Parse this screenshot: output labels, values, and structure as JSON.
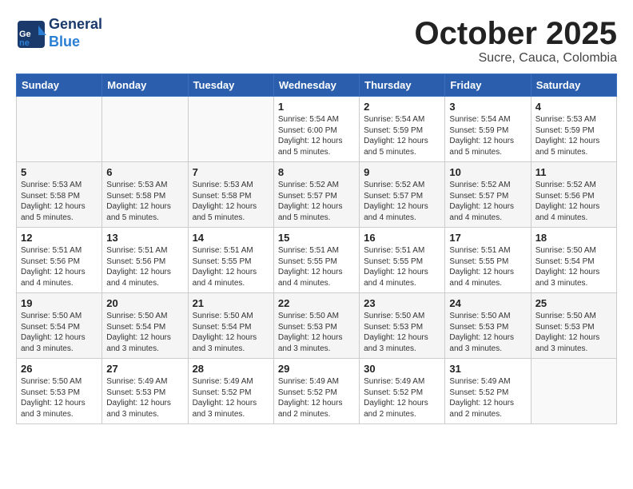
{
  "header": {
    "logo_general": "General",
    "logo_blue": "Blue",
    "month_title": "October 2025",
    "subtitle": "Sucre, Cauca, Colombia"
  },
  "calendar": {
    "days_of_week": [
      "Sunday",
      "Monday",
      "Tuesday",
      "Wednesday",
      "Thursday",
      "Friday",
      "Saturday"
    ],
    "weeks": [
      [
        {
          "day": "",
          "info": ""
        },
        {
          "day": "",
          "info": ""
        },
        {
          "day": "",
          "info": ""
        },
        {
          "day": "1",
          "info": "Sunrise: 5:54 AM\nSunset: 6:00 PM\nDaylight: 12 hours and 5 minutes."
        },
        {
          "day": "2",
          "info": "Sunrise: 5:54 AM\nSunset: 5:59 PM\nDaylight: 12 hours and 5 minutes."
        },
        {
          "day": "3",
          "info": "Sunrise: 5:54 AM\nSunset: 5:59 PM\nDaylight: 12 hours and 5 minutes."
        },
        {
          "day": "4",
          "info": "Sunrise: 5:53 AM\nSunset: 5:59 PM\nDaylight: 12 hours and 5 minutes."
        }
      ],
      [
        {
          "day": "5",
          "info": "Sunrise: 5:53 AM\nSunset: 5:58 PM\nDaylight: 12 hours and 5 minutes."
        },
        {
          "day": "6",
          "info": "Sunrise: 5:53 AM\nSunset: 5:58 PM\nDaylight: 12 hours and 5 minutes."
        },
        {
          "day": "7",
          "info": "Sunrise: 5:53 AM\nSunset: 5:58 PM\nDaylight: 12 hours and 5 minutes."
        },
        {
          "day": "8",
          "info": "Sunrise: 5:52 AM\nSunset: 5:57 PM\nDaylight: 12 hours and 5 minutes."
        },
        {
          "day": "9",
          "info": "Sunrise: 5:52 AM\nSunset: 5:57 PM\nDaylight: 12 hours and 4 minutes."
        },
        {
          "day": "10",
          "info": "Sunrise: 5:52 AM\nSunset: 5:57 PM\nDaylight: 12 hours and 4 minutes."
        },
        {
          "day": "11",
          "info": "Sunrise: 5:52 AM\nSunset: 5:56 PM\nDaylight: 12 hours and 4 minutes."
        }
      ],
      [
        {
          "day": "12",
          "info": "Sunrise: 5:51 AM\nSunset: 5:56 PM\nDaylight: 12 hours and 4 minutes."
        },
        {
          "day": "13",
          "info": "Sunrise: 5:51 AM\nSunset: 5:56 PM\nDaylight: 12 hours and 4 minutes."
        },
        {
          "day": "14",
          "info": "Sunrise: 5:51 AM\nSunset: 5:55 PM\nDaylight: 12 hours and 4 minutes."
        },
        {
          "day": "15",
          "info": "Sunrise: 5:51 AM\nSunset: 5:55 PM\nDaylight: 12 hours and 4 minutes."
        },
        {
          "day": "16",
          "info": "Sunrise: 5:51 AM\nSunset: 5:55 PM\nDaylight: 12 hours and 4 minutes."
        },
        {
          "day": "17",
          "info": "Sunrise: 5:51 AM\nSunset: 5:55 PM\nDaylight: 12 hours and 4 minutes."
        },
        {
          "day": "18",
          "info": "Sunrise: 5:50 AM\nSunset: 5:54 PM\nDaylight: 12 hours and 3 minutes."
        }
      ],
      [
        {
          "day": "19",
          "info": "Sunrise: 5:50 AM\nSunset: 5:54 PM\nDaylight: 12 hours and 3 minutes."
        },
        {
          "day": "20",
          "info": "Sunrise: 5:50 AM\nSunset: 5:54 PM\nDaylight: 12 hours and 3 minutes."
        },
        {
          "day": "21",
          "info": "Sunrise: 5:50 AM\nSunset: 5:54 PM\nDaylight: 12 hours and 3 minutes."
        },
        {
          "day": "22",
          "info": "Sunrise: 5:50 AM\nSunset: 5:53 PM\nDaylight: 12 hours and 3 minutes."
        },
        {
          "day": "23",
          "info": "Sunrise: 5:50 AM\nSunset: 5:53 PM\nDaylight: 12 hours and 3 minutes."
        },
        {
          "day": "24",
          "info": "Sunrise: 5:50 AM\nSunset: 5:53 PM\nDaylight: 12 hours and 3 minutes."
        },
        {
          "day": "25",
          "info": "Sunrise: 5:50 AM\nSunset: 5:53 PM\nDaylight: 12 hours and 3 minutes."
        }
      ],
      [
        {
          "day": "26",
          "info": "Sunrise: 5:50 AM\nSunset: 5:53 PM\nDaylight: 12 hours and 3 minutes."
        },
        {
          "day": "27",
          "info": "Sunrise: 5:49 AM\nSunset: 5:53 PM\nDaylight: 12 hours and 3 minutes."
        },
        {
          "day": "28",
          "info": "Sunrise: 5:49 AM\nSunset: 5:52 PM\nDaylight: 12 hours and 3 minutes."
        },
        {
          "day": "29",
          "info": "Sunrise: 5:49 AM\nSunset: 5:52 PM\nDaylight: 12 hours and 2 minutes."
        },
        {
          "day": "30",
          "info": "Sunrise: 5:49 AM\nSunset: 5:52 PM\nDaylight: 12 hours and 2 minutes."
        },
        {
          "day": "31",
          "info": "Sunrise: 5:49 AM\nSunset: 5:52 PM\nDaylight: 12 hours and 2 minutes."
        },
        {
          "day": "",
          "info": ""
        }
      ]
    ]
  }
}
